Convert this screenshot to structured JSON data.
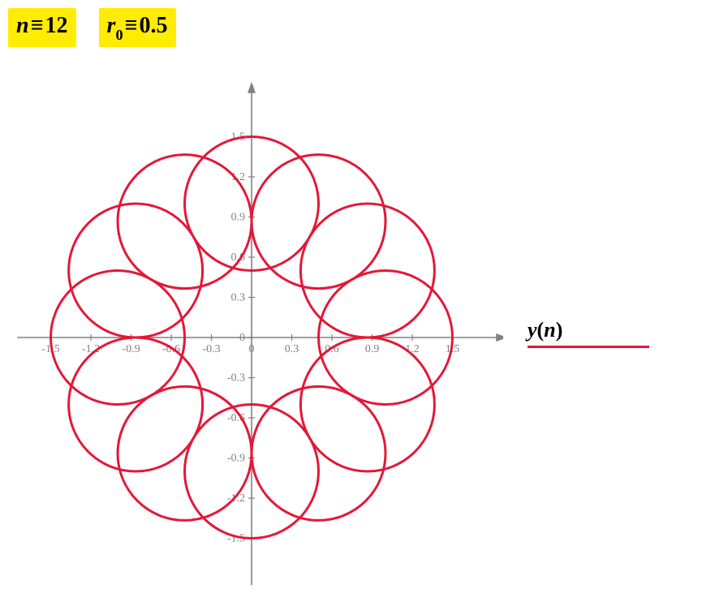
{
  "params": {
    "n_var": "n",
    "n_value": "12",
    "r0_var_main": "r",
    "r0_var_sub": "0",
    "r0_value": "0.5",
    "equiv_symbol": "≡"
  },
  "legend": {
    "label_full": "y(n)",
    "label_y": "y",
    "label_paren_open": "(",
    "label_var": "n",
    "label_paren_close": ")"
  },
  "chart_data": {
    "type": "scatter",
    "title": "",
    "xlabel": "",
    "ylabel": "",
    "xlim": [
      -1.7,
      1.7
    ],
    "ylim": [
      -1.7,
      1.7
    ],
    "n_circles": 12,
    "circle_radius": 0.5,
    "center_radius": 1.0,
    "x_ticks": [
      -1.5,
      -1.2,
      -0.9,
      -0.6,
      -0.3,
      0,
      0.3,
      0.6,
      0.9,
      1.2,
      1.5
    ],
    "y_ticks": [
      -1.5,
      -1.2,
      -0.9,
      -0.6,
      -0.3,
      0,
      0.3,
      0.6,
      0.9,
      1.2,
      1.5
    ],
    "x_tick_labels": [
      "-1.5",
      "-1.2",
      "-0.9",
      "-0.6",
      "-0.3",
      "0",
      "0.3",
      "0.6",
      "0.9",
      "1.2",
      "1.5"
    ],
    "y_tick_labels": [
      "-1.5",
      "-1.2",
      "-0.9",
      "-0.6",
      "-0.3",
      "0",
      "0.3",
      "0.6",
      "0.9",
      "1.2",
      "1.5"
    ],
    "circle_centers_x": [
      1.0,
      0.866,
      0.5,
      0.0,
      -0.5,
      -0.866,
      -1.0,
      -0.866,
      -0.5,
      0.0,
      0.5,
      0.866
    ],
    "circle_centers_y": [
      0.0,
      0.5,
      0.866,
      1.0,
      0.866,
      0.5,
      0.0,
      -0.5,
      -0.866,
      -1.0,
      -0.866,
      -0.5
    ],
    "series_color": "#e31837"
  }
}
